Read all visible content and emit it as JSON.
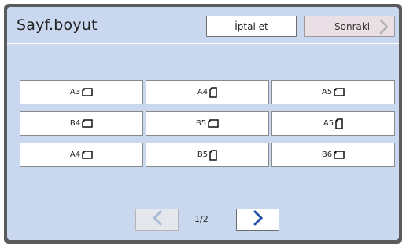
{
  "dialog": {
    "title": "Sayf.boyut",
    "cancel_label": "İptal et",
    "next_label": "Sonraki"
  },
  "sizes": [
    {
      "label": "A3",
      "orientation": "landscape"
    },
    {
      "label": "A4",
      "orientation": "portrait"
    },
    {
      "label": "A5",
      "orientation": "landscape"
    },
    {
      "label": "B4",
      "orientation": "landscape"
    },
    {
      "label": "B5",
      "orientation": "landscape"
    },
    {
      "label": "A5",
      "orientation": "portrait"
    },
    {
      "label": "A4",
      "orientation": "landscape"
    },
    {
      "label": "B5",
      "orientation": "portrait"
    },
    {
      "label": "B6",
      "orientation": "landscape"
    }
  ],
  "pagination": {
    "indicator": "1/2",
    "prev_enabled": false,
    "next_enabled": true
  },
  "colors": {
    "panel": "#c9d8ee",
    "frame": "#5b5b5b",
    "accent": "#1f4fa8",
    "disabled": "#9fb3cf"
  }
}
